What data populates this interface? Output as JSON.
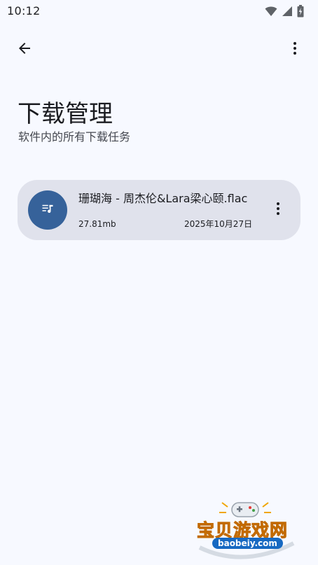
{
  "status_bar": {
    "time": "10:12"
  },
  "icons": {
    "back": "arrow-left-icon",
    "menu": "more-vertical-icon",
    "file": "music-queue-icon",
    "item_menu": "more-vertical-icon",
    "wifi": "wifi-icon",
    "signal": "signal-icon",
    "battery": "battery-charging-icon"
  },
  "header": {
    "title": "下载管理",
    "subtitle": "软件内的所有下载任务"
  },
  "downloads": [
    {
      "name": "珊瑚海 - 周杰伦&Lara梁心颐.flac",
      "size": "27.81mb",
      "date": "2025年10月27日"
    }
  ],
  "colors": {
    "background": "#f7f9ff",
    "card": "#e0e2ec",
    "avatar": "#36629a"
  },
  "watermark": {
    "name": "宝贝游戏网",
    "url": "baobeiy.com"
  }
}
